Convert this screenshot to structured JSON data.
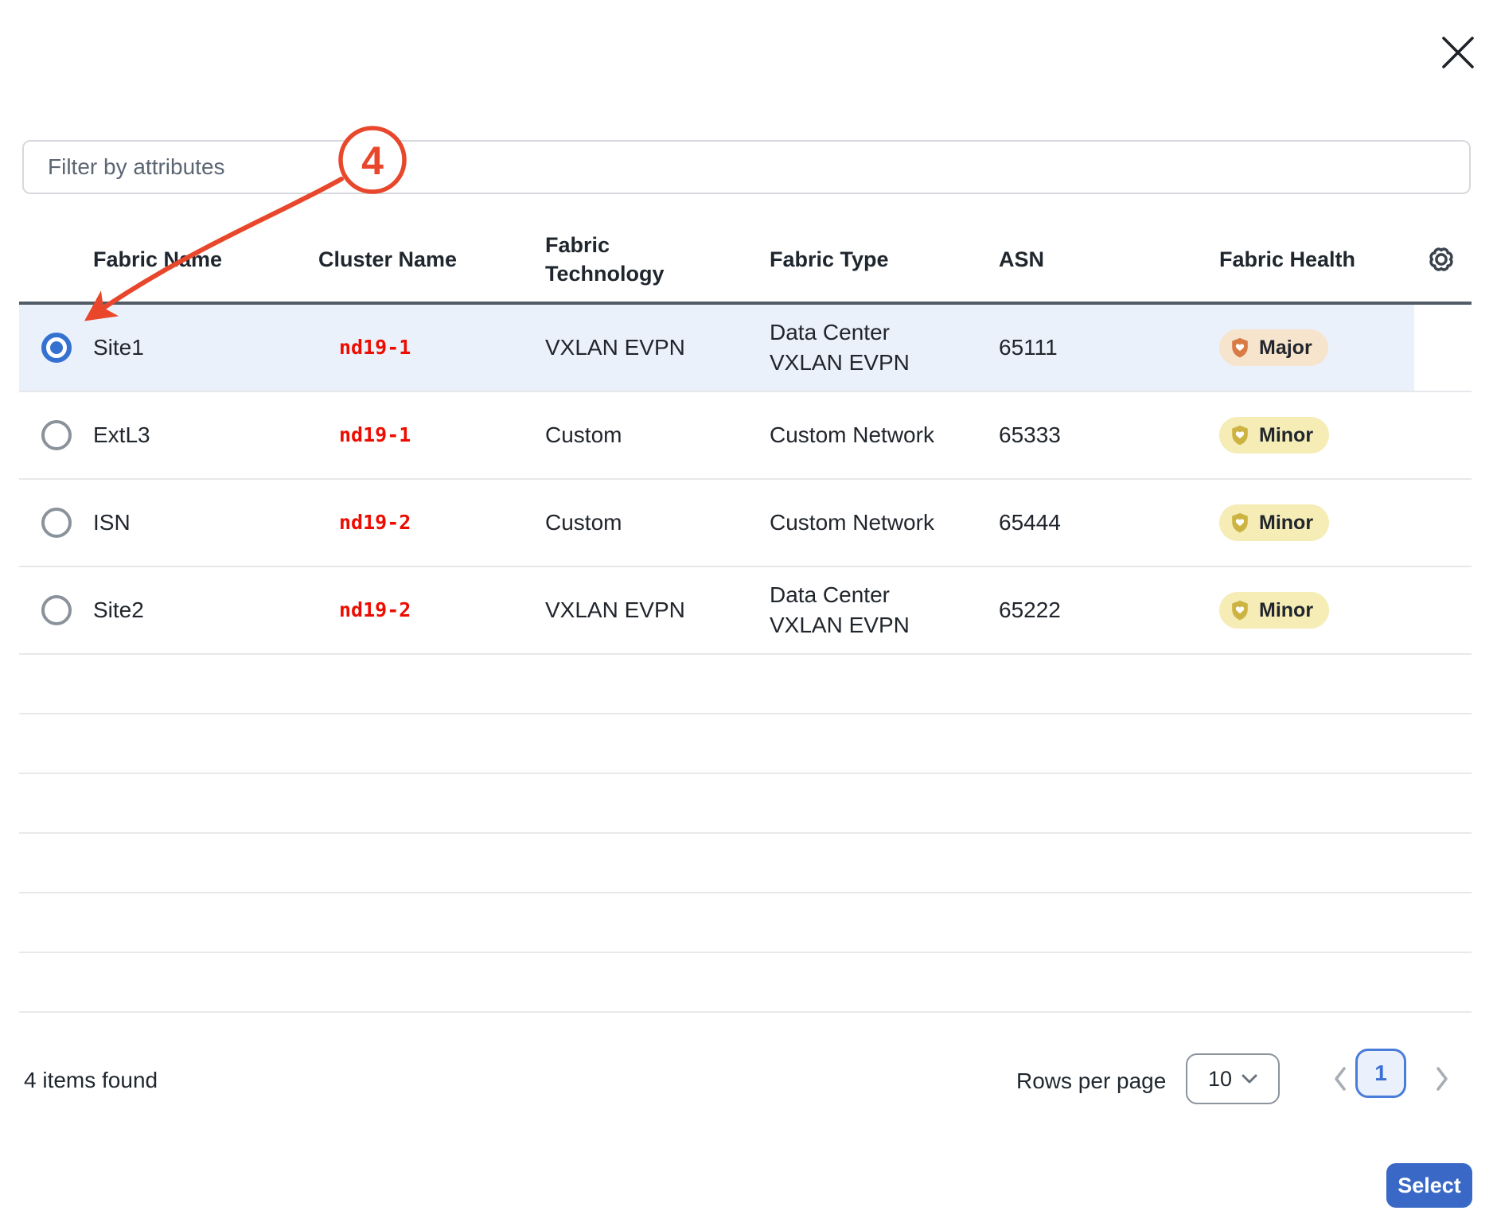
{
  "modal": {
    "close_icon": "close-icon",
    "settings_icon": "gear-icon"
  },
  "filter": {
    "placeholder": "Filter by attributes",
    "value": ""
  },
  "annotation": {
    "step_number": "4",
    "color": "#e8472b",
    "target": "row-site1-radio"
  },
  "table": {
    "columns": [
      "Fabric Name",
      "Cluster Name",
      "Fabric Technology",
      "Fabric Type",
      "ASN",
      "Fabric Health"
    ],
    "rows": [
      {
        "fabric_name": "Site1",
        "cluster_name": "nd19-1",
        "fabric_technology": "VXLAN EVPN",
        "fabric_type": "Data Center VXLAN EVPN",
        "asn": "65111",
        "fabric_health": "Major",
        "selected": true
      },
      {
        "fabric_name": "ExtL3",
        "cluster_name": "nd19-1",
        "fabric_technology": "Custom",
        "fabric_type": "Custom Network",
        "asn": "65333",
        "fabric_health": "Minor",
        "selected": false
      },
      {
        "fabric_name": "ISN",
        "cluster_name": "nd19-2",
        "fabric_technology": "Custom",
        "fabric_type": "Custom Network",
        "asn": "65444",
        "fabric_health": "Minor",
        "selected": false
      },
      {
        "fabric_name": "Site2",
        "cluster_name": "nd19-2",
        "fabric_technology": "VXLAN EVPN",
        "fabric_type": "Data Center VXLAN EVPN",
        "asn": "65222",
        "fabric_health": "Minor",
        "selected": false
      }
    ],
    "empty_row_count": 6,
    "health_styles": {
      "major": {
        "bg": "#f7e4cc",
        "icon": "#d97b45"
      },
      "minor": {
        "bg": "#f5ecb6",
        "icon": "#cdb442"
      }
    },
    "cluster_link_color": "#ed0c00",
    "selected_row_bg": "#eaf1fb"
  },
  "footer": {
    "items_found": "4 items found",
    "rows_per_page_label": "Rows per page",
    "rows_per_page_value": "10",
    "current_page": "1"
  },
  "actions": {
    "select_label": "Select",
    "accent_color": "#3968c6"
  }
}
